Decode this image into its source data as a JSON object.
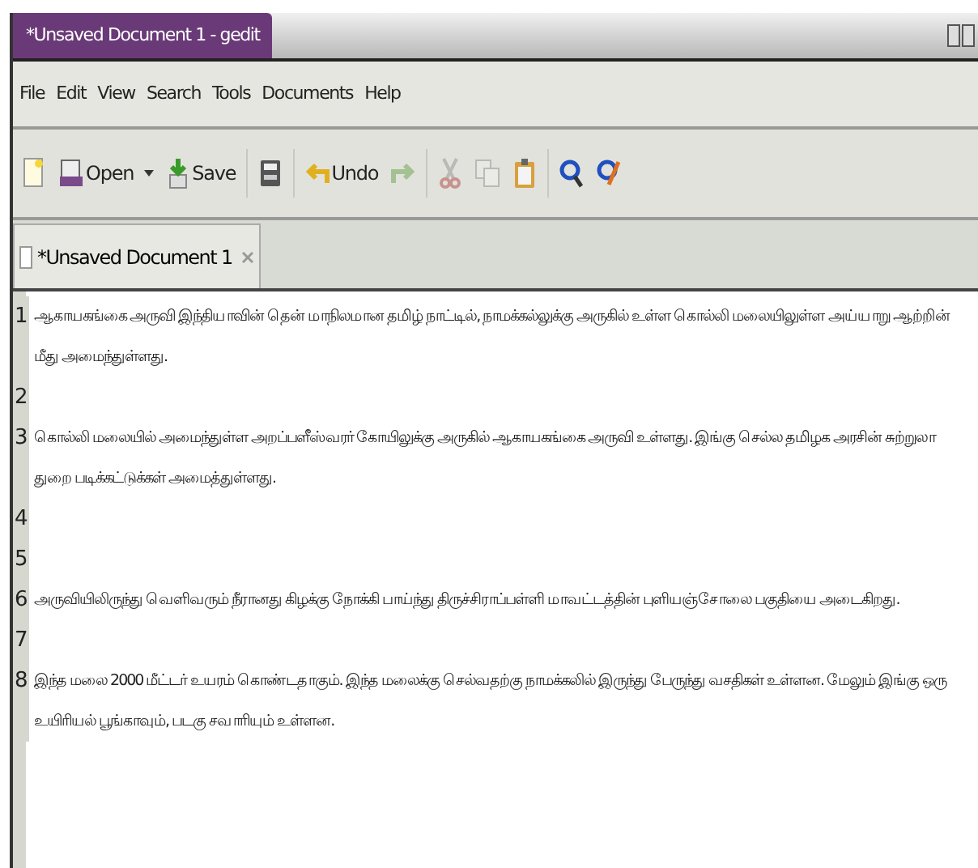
{
  "window": {
    "title": "*Unsaved Document 1 - gedit"
  },
  "menu": [
    "File",
    "Edit",
    "View",
    "Search",
    "Tools",
    "Documents",
    "Help"
  ],
  "toolbar": [
    {
      "kind": "new",
      "disabled": false
    },
    {
      "kind": "open",
      "label": "Open",
      "disabled": false
    },
    {
      "kind": "save",
      "label": "Save",
      "disabled": false
    },
    {
      "kind": "print",
      "disabled": false
    },
    {
      "kind": "undo",
      "label": "Undo",
      "disabled": false
    },
    {
      "kind": "redo",
      "disabled": true
    },
    {
      "kind": "cut",
      "disabled": true
    },
    {
      "kind": "copy",
      "disabled": true
    },
    {
      "kind": "paste",
      "disabled": false
    },
    {
      "kind": "find",
      "disabled": false
    },
    {
      "kind": "replace",
      "disabled": false
    }
  ],
  "tabs": [
    {
      "label": "*Unsaved Document 1",
      "selected": true
    }
  ],
  "lines": [
    {
      "number": "1",
      "text": "ஆகாயகங்கை அருவி இந்தியாவின் தென் மாநிலமான தமிழ் நாட்டில், நாமக்கல்லுக்கு அருகில் உள்ள கொல்லி மலையிலுள்ள அய்யாறு ஆற்றின் மீது அமைந்துள்ளது."
    },
    {
      "number": "2"
    },
    {
      "number": "3",
      "text": "கொல்லி மலையில் அமைந்துள்ள அறப்பளீஸ்வரர் கோயிலுக்கு அருகில் ஆகாயகங்கை அருவி உள்ளது. இங்கு செல்ல தமிழக அரசின் சுற்றுலா துறை படிக்கட்டுக்கள் அமைத்துள்ளது."
    },
    {
      "number": "4"
    },
    {
      "number": "5"
    },
    {
      "number": "6",
      "text": "அருவியிலிருந்து வெளிவரும் நீரானது கிழக்கு நோக்கி பாய்ந்து திருச்சிராப்பள்ளி மாவட்டத்தின் புளியஞ்சோலை பகுதியை அடைகிறது."
    },
    {
      "number": "7"
    },
    {
      "number": "8",
      "text": "இந்த மலை 2000 மீட்டர் உயரம் கொண்டதாகும். இந்த மலைக்கு செல்வதற்கு நாமக்கலில் இருந்து பேருந்து வசதிகள் உள்ளன. மேலும் இங்கு ஒரு உயிரியல் பூங்காவும், படகு சவாரியும் உள்ளன."
    }
  ]
}
